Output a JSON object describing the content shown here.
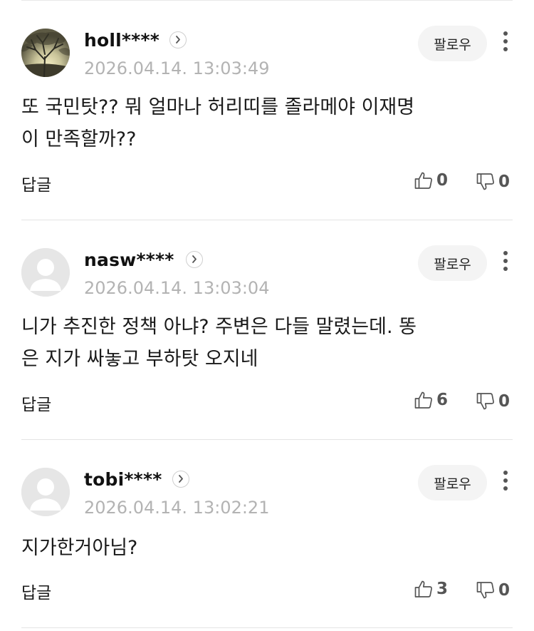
{
  "comments": [
    {
      "username": "holl****",
      "timestamp": "2026.04.14. 13:03:49",
      "text_lines": [
        "또 국민탓?? 뭐 얼마나 허리띠를 졸라메야 이재명",
        "이 만족할까??"
      ],
      "follow_label": "팔로우",
      "reply_label": "답글",
      "likes": "0",
      "dislikes": "0",
      "avatar": "photo"
    },
    {
      "username": "nasw****",
      "timestamp": "2026.04.14. 13:03:04",
      "text_lines": [
        "니가 추진한 정책 아냐? 주변은 다들 말렸는데. 똥",
        "은 지가 싸놓고 부하탓 오지네"
      ],
      "follow_label": "팔로우",
      "reply_label": "답글",
      "likes": "6",
      "dislikes": "0",
      "avatar": "default"
    },
    {
      "username": "tobi****",
      "timestamp": "2026.04.14. 13:02:21",
      "text_lines": [
        "지가한거아님?"
      ],
      "follow_label": "팔로우",
      "reply_label": "답글",
      "likes": "3",
      "dislikes": "0",
      "avatar": "default"
    }
  ],
  "icons": {
    "profile_link": "chevron-right-icon",
    "more": "more-vertical-icon",
    "like": "thumbs-up-icon",
    "dislike": "thumbs-down-icon",
    "default_avatar": "user-silhouette-icon"
  },
  "colors": {
    "background": "#ffffff",
    "text": "#1a1a1a",
    "timestamp": "#b3b3b3",
    "follow_bg": "#f4f4f4",
    "divider": "#e4e4e4"
  }
}
